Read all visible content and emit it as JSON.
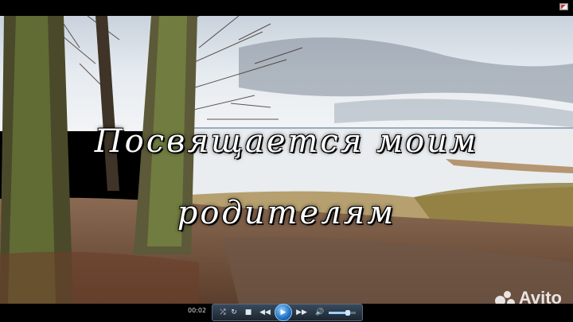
{
  "video": {
    "caption_line1": "Посвящается моим",
    "caption_line2": "родителям"
  },
  "player": {
    "time": "00:02",
    "volume_level": 0.7,
    "buttons": {
      "shuffle": "⤮",
      "repeat": "↻",
      "stop": "■",
      "prev": "◀◀",
      "play": "▶",
      "next": "▶▶",
      "mute": "🔊"
    }
  },
  "watermark": {
    "text": "Avito"
  },
  "colors": {
    "player_accent": "#1f6fc4",
    "sky": "#dde3ea",
    "water": "#eef1f3",
    "leaves": "#7a4a30"
  }
}
